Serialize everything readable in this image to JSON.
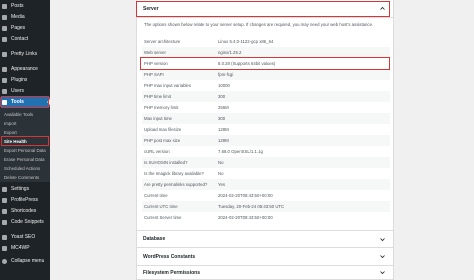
{
  "sidebar": {
    "items": [
      {
        "label": "Posts",
        "icon": "pin-icon"
      },
      {
        "label": "Media",
        "icon": "media-icon"
      },
      {
        "label": "Pages",
        "icon": "pages-icon"
      },
      {
        "label": "Contact",
        "icon": "mail-icon"
      },
      {
        "label": "Pretty Links",
        "icon": "link-icon"
      },
      {
        "label": "Appearance",
        "icon": "paintbrush-icon"
      },
      {
        "label": "Plugins",
        "icon": "plugin-icon"
      },
      {
        "label": "Users",
        "icon": "users-icon"
      },
      {
        "label": "Tools",
        "icon": "wrench-icon"
      },
      {
        "label": "Settings",
        "icon": "settings-icon"
      },
      {
        "label": "ProfilePress",
        "icon": "profile-icon"
      },
      {
        "label": "Shortcodes",
        "icon": "shortcode-icon"
      },
      {
        "label": "Code Snippets",
        "icon": "code-icon"
      },
      {
        "label": "Yoast SEO",
        "icon": "yoast-icon"
      },
      {
        "label": "MC4WP",
        "icon": "mailchimp-icon"
      },
      {
        "label": "Collapse menu",
        "icon": "collapse-icon"
      }
    ],
    "submenu": [
      "Available Tools",
      "Import",
      "Export",
      "Site Health",
      "Export Personal Data",
      "Erase Personal Data",
      "Scheduled Actions",
      "Delete Comments"
    ]
  },
  "server_section": {
    "title": "Server",
    "intro": "The options shown below relate to your server setup. If changes are required, you may need your web host's assistance.",
    "rows": [
      {
        "key": "Server architecture",
        "value": "Linux 5.4.0-1122-gcp x86_64"
      },
      {
        "key": "Web server",
        "value": "nginx/1.25.2"
      },
      {
        "key": "PHP version",
        "value": "8.0.28 (Supports 64bit values)"
      },
      {
        "key": "PHP SAPI",
        "value": "fpm-fcgi"
      },
      {
        "key": "PHP max input variables",
        "value": "10000"
      },
      {
        "key": "PHP time limit",
        "value": "300"
      },
      {
        "key": "PHP memory limit",
        "value": "256M"
      },
      {
        "key": "Max input time",
        "value": "300"
      },
      {
        "key": "Upload max filesize",
        "value": "128M"
      },
      {
        "key": "PHP post max size",
        "value": "128M"
      },
      {
        "key": "cURL version",
        "value": "7.68.0 OpenSSL/1.1.1g"
      },
      {
        "key": "Is SUHOSIN installed?",
        "value": "No"
      },
      {
        "key": "Is the Imagick library available?",
        "value": "No"
      },
      {
        "key": "Are pretty permalinks supported?",
        "value": "Yes"
      },
      {
        "key": "Current time",
        "value": "2024-02-20T08:43:50+00:00"
      },
      {
        "key": "Current UTC time",
        "value": "Tuesday, 20-Feb-24 08:43:50 UTC"
      },
      {
        "key": "Current Server time",
        "value": "2024-02-20T08:43:50+00:00"
      }
    ]
  },
  "collapsed_sections": [
    {
      "title": "Database"
    },
    {
      "title": "WordPress Constants"
    },
    {
      "title": "Filesystem Permissions"
    }
  ],
  "colors": {
    "sidebar": "#1d2327",
    "active": "#2271b1",
    "highlight": "#d63638"
  }
}
